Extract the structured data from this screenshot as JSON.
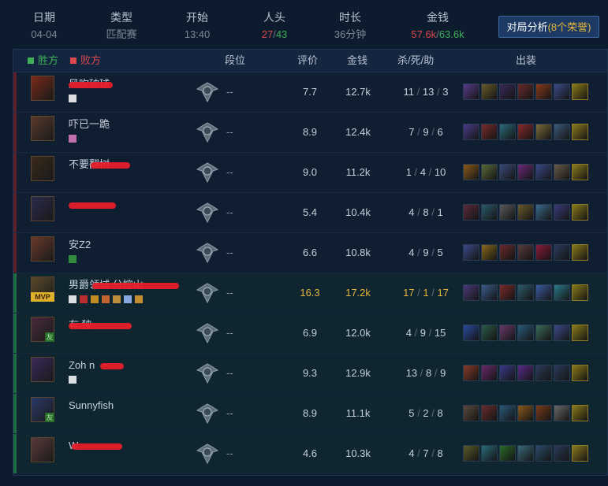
{
  "summary": {
    "date": {
      "label": "日期",
      "value": "04-04"
    },
    "type": {
      "label": "类型",
      "value": "匹配赛"
    },
    "start": {
      "label": "开始",
      "value": "13:40"
    },
    "kills": {
      "label": "人头",
      "win": "27",
      "sep": "/",
      "loss": "43"
    },
    "duration": {
      "label": "时长",
      "value": "36分钟"
    },
    "gold": {
      "label": "金钱",
      "win": "57.6k",
      "sep": "/",
      "loss": "63.6k"
    }
  },
  "analyze_button": {
    "label": "对局分析",
    "honor": "(8个荣誉)"
  },
  "table": {
    "legend_win": "胜方",
    "legend_loss": "败方",
    "headers": {
      "rank": "段位",
      "score": "评价",
      "gold": "金钱",
      "kda": "杀/死/助",
      "items": "出装"
    }
  },
  "colors": {
    "win": "#3fae58",
    "loss": "#d8484d",
    "gold": "#e5b43c"
  },
  "rows": [
    {
      "team": "loss",
      "name": "风吹破球",
      "rank": "--",
      "score": "7.7",
      "gold": "12.7k",
      "k": "11",
      "d": "13",
      "a": "3",
      "mvp": "",
      "friend": ""
    },
    {
      "team": "loss",
      "name": "吓已一跪",
      "rank": "--",
      "score": "8.9",
      "gold": "12.4k",
      "k": "7",
      "d": "9",
      "a": "6",
      "mvp": "",
      "friend": ""
    },
    {
      "team": "loss",
      "name": "不要翻树",
      "rank": "--",
      "score": "9.0",
      "gold": "11.2k",
      "k": "1",
      "d": "4",
      "a": "10",
      "mvp": "",
      "friend": ""
    },
    {
      "team": "loss",
      "name": "",
      "rank": "--",
      "score": "5.4",
      "gold": "10.4k",
      "k": "4",
      "d": "8",
      "a": "1",
      "mvp": "",
      "friend": ""
    },
    {
      "team": "loss",
      "name": "安Z2",
      "rank": "--",
      "score": "6.6",
      "gold": "10.8k",
      "k": "4",
      "d": "9",
      "a": "5",
      "mvp": "",
      "friend": ""
    },
    {
      "team": "win",
      "name": "男爵领域 分控山",
      "rank": "--",
      "score": "16.3",
      "gold": "17.2k",
      "k": "17",
      "d": "1",
      "a": "17",
      "mvp": "MVP",
      "friend": ""
    },
    {
      "team": "win",
      "name": "有 狭",
      "rank": "--",
      "score": "6.9",
      "gold": "12.0k",
      "k": "4",
      "d": "9",
      "a": "15",
      "mvp": "",
      "friend": "友"
    },
    {
      "team": "win",
      "name": "Zoh n",
      "rank": "--",
      "score": "9.3",
      "gold": "12.9k",
      "k": "13",
      "d": "8",
      "a": "9",
      "mvp": "",
      "friend": ""
    },
    {
      "team": "win",
      "name": "Sunnyfish",
      "rank": "--",
      "score": "8.9",
      "gold": "11.1k",
      "k": "5",
      "d": "2",
      "a": "8",
      "mvp": "",
      "friend": "友"
    },
    {
      "team": "win",
      "name": "W",
      "rank": "--",
      "score": "4.6",
      "gold": "10.3k",
      "k": "4",
      "d": "7",
      "a": "8",
      "mvp": "",
      "friend": ""
    }
  ]
}
